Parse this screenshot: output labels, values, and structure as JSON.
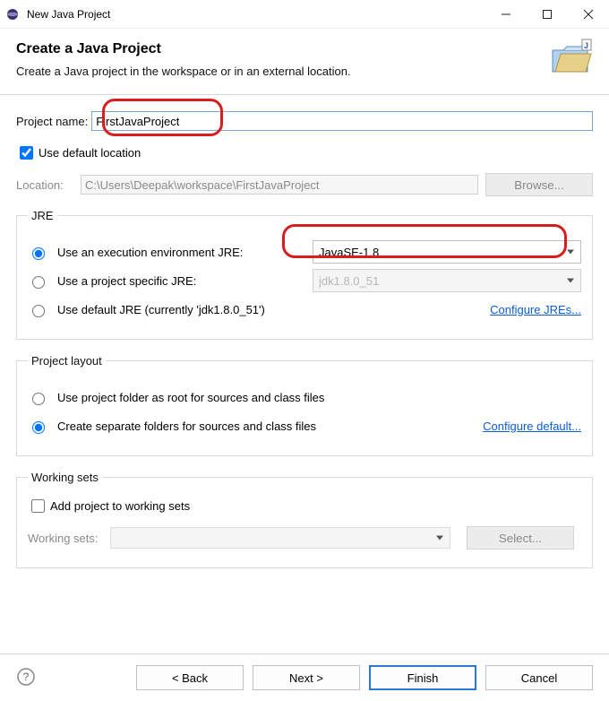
{
  "window": {
    "title": "New Java Project"
  },
  "header": {
    "title": "Create a Java Project",
    "subtitle": "Create a Java project in the workspace or in an external location."
  },
  "project": {
    "name_label": "Project name:",
    "name_value": "FirstJavaProject",
    "use_default_label": "Use default location",
    "location_label": "Location:",
    "location_value": "C:\\Users\\Deepak\\workspace\\FirstJavaProject",
    "browse_label": "Browse..."
  },
  "jre_group": {
    "legend": "JRE",
    "opt_exec_env": "Use an execution environment JRE:",
    "exec_env_value": "JavaSE-1.8",
    "opt_project_specific": "Use a project specific JRE:",
    "project_specific_value": "jdk1.8.0_51",
    "opt_default": "Use default JRE (currently 'jdk1.8.0_51')",
    "configure_link": "Configure JREs..."
  },
  "layout_group": {
    "legend": "Project layout",
    "opt_root": "Use project folder as root for sources and class files",
    "opt_separate": "Create separate folders for sources and class files",
    "configure_link": "Configure default..."
  },
  "working_group": {
    "legend": "Working sets",
    "add_label": "Add project to working sets",
    "list_label": "Working sets:",
    "select_btn": "Select..."
  },
  "buttons": {
    "back": "< Back",
    "next": "Next >",
    "finish": "Finish",
    "cancel": "Cancel"
  }
}
